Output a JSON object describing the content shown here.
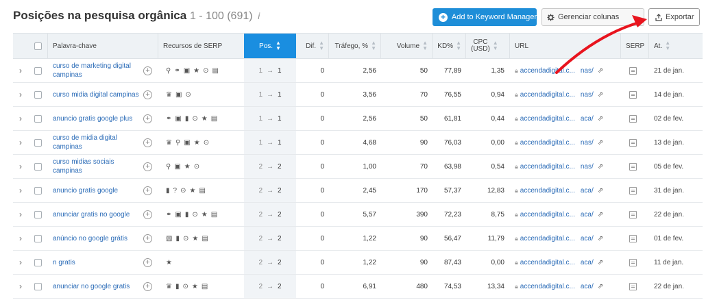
{
  "header": {
    "title": "Posições na pesquisa orgânica",
    "range": "1 - 100 (691)",
    "info_glyph": "i",
    "add_button": "Add to Keyword Manager",
    "columns_button": "Gerenciar colunas",
    "export_button": "Exportar"
  },
  "columns": {
    "keyword": "Palavra-chave",
    "serp_features": "Recursos de SERP",
    "position": "Pos.",
    "difference": "Dif.",
    "traffic": "Tráfego, %",
    "volume": "Volume",
    "kd": "KD%",
    "cpc": "CPC",
    "cpc_unit": "(USD)",
    "url": "URL",
    "serp": "SERP",
    "updated": "At."
  },
  "accent_colors": {
    "primary_blue": "#1e8ed8",
    "link_blue": "#2a6bb7",
    "arrow_red": "#e8141e"
  },
  "rows": [
    {
      "keyword": "curso de marketing digital campinas",
      "serp": [
        "location-pin-icon",
        "link-icon",
        "image-pack-icon",
        "star-icon",
        "video-icon",
        "carousel-icon"
      ],
      "pos_old": "1",
      "pos_new": "1",
      "dif": "0",
      "traffic": "2,56",
      "volume": "50",
      "kd": "77,89",
      "cpc": "1,35",
      "url_a": "accendadigital.c...",
      "url_b": "nas/",
      "date": "21 de jan."
    },
    {
      "keyword": "curso midia digital campinas",
      "serp": [
        "crown-icon",
        "image-pack-icon",
        "video-icon"
      ],
      "pos_old": "1",
      "pos_new": "1",
      "dif": "0",
      "traffic": "3,56",
      "volume": "70",
      "kd": "76,55",
      "cpc": "0,94",
      "url_a": "accendadigital.c...",
      "url_b": "nas/",
      "date": "14 de jan."
    },
    {
      "keyword": "anuncio gratis google plus",
      "serp": [
        "link-icon",
        "image-pack-icon",
        "knowledge-panel-icon",
        "video-icon",
        "star-icon",
        "carousel-icon"
      ],
      "pos_old": "1",
      "pos_new": "1",
      "dif": "0",
      "traffic": "2,56",
      "volume": "50",
      "kd": "61,81",
      "cpc": "0,44",
      "url_a": "accendadigital.c...",
      "url_b": "aca/",
      "date": "02 de fev."
    },
    {
      "keyword": "curso de midia digital campinas",
      "serp": [
        "crown-icon",
        "location-pin-icon",
        "image-pack-icon",
        "star-icon",
        "video-icon"
      ],
      "pos_old": "1",
      "pos_new": "1",
      "dif": "0",
      "traffic": "4,68",
      "volume": "90",
      "kd": "76,03",
      "cpc": "0,00",
      "url_a": "accendadigital.c...",
      "url_b": "nas/",
      "date": "13 de jan."
    },
    {
      "keyword": "curso midias sociais campinas",
      "serp": [
        "location-pin-icon",
        "image-pack-icon",
        "star-icon",
        "video-icon"
      ],
      "pos_old": "2",
      "pos_new": "2",
      "dif": "0",
      "traffic": "1,00",
      "volume": "70",
      "kd": "63,98",
      "cpc": "0,54",
      "url_a": "accendadigital.c...",
      "url_b": "nas/",
      "date": "05 de fev."
    },
    {
      "keyword": "anuncio gratis google",
      "serp": [
        "knowledge-panel-icon",
        "question-icon",
        "video-icon",
        "star-icon",
        "carousel-icon"
      ],
      "pos_old": "2",
      "pos_new": "2",
      "dif": "0",
      "traffic": "2,45",
      "volume": "170",
      "kd": "57,37",
      "cpc": "12,83",
      "url_a": "accendadigital.c...",
      "url_b": "aca/",
      "date": "31 de jan."
    },
    {
      "keyword": "anunciar gratis no google",
      "serp": [
        "link-icon",
        "image-pack-icon",
        "knowledge-panel-icon",
        "video-icon",
        "star-icon",
        "carousel-icon"
      ],
      "pos_old": "2",
      "pos_new": "2",
      "dif": "0",
      "traffic": "5,57",
      "volume": "390",
      "kd": "72,23",
      "cpc": "8,75",
      "url_a": "accendadigital.c...",
      "url_b": "aca/",
      "date": "22 de jan."
    },
    {
      "keyword": "anúncio no google grátis",
      "serp": [
        "image-icon",
        "knowledge-panel-icon",
        "video-icon",
        "star-icon",
        "carousel-icon"
      ],
      "pos_old": "2",
      "pos_new": "2",
      "dif": "0",
      "traffic": "1,22",
      "volume": "90",
      "kd": "56,47",
      "cpc": "11,79",
      "url_a": "accendadigital.c...",
      "url_b": "aca/",
      "date": "01 de fev."
    },
    {
      "keyword": "n gratis",
      "serp": [
        "star-icon"
      ],
      "pos_old": "2",
      "pos_new": "2",
      "dif": "0",
      "traffic": "1,22",
      "volume": "90",
      "kd": "87,43",
      "cpc": "0,00",
      "url_a": "accendadigital.c...",
      "url_b": "aca/",
      "date": "11 de jan."
    },
    {
      "keyword": "anunciar no google gratis",
      "serp": [
        "crown-icon",
        "knowledge-panel-icon",
        "video-icon",
        "star-icon",
        "carousel-icon"
      ],
      "pos_old": "2",
      "pos_new": "2",
      "dif": "0",
      "traffic": "6,91",
      "volume": "480",
      "kd": "74,53",
      "cpc": "13,34",
      "url_a": "accendadigital.c...",
      "url_b": "aca/",
      "date": "22 de jan."
    }
  ]
}
